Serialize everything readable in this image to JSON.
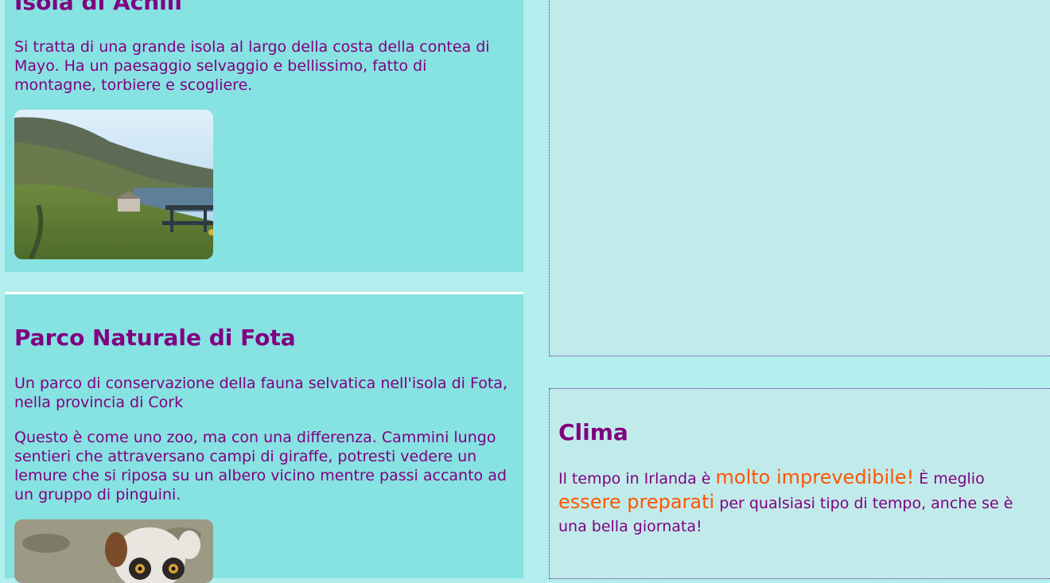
{
  "sections": [
    {
      "title": "Isola di Achill",
      "paragraphs": [
        "Si tratta di una grande isola al largo della costa della contea di Mayo. Ha un paesaggio selvaggio e bellissimo, fatto di montagne, torbiere e scogliere."
      ],
      "image_desc": "coastal landscape with cottage and picnic bench"
    },
    {
      "title": "Parco Naturale di Fota",
      "paragraphs": [
        "Un parco di conservazione della fauna selvatica nell'isola di Fota, nella provincia di Cork",
        "Questo è come uno zoo, ma con una differenza. Cammini lungo sentieri che attraversano campi di giraffe, potresti vedere un lemure che si riposa su un albero vicino mentre passi accanto ad un gruppo di pinguini."
      ],
      "image_desc": "ring-tailed lemur"
    }
  ],
  "clima": {
    "title": "Clima",
    "text_1": "Il tempo in Irlanda è ",
    "highlight_1": "molto imprevedibile!",
    "text_2": " È meglio ",
    "highlight_2": "essere preparati",
    "text_3": " per qualsiasi tipo di tempo, anche se è una bella giornata!"
  },
  "colors": {
    "page_bg": "#b2eeee",
    "card_bg": "#87e2e2",
    "sidebar_bg": "#c1ebeb",
    "text": "#800080",
    "highlight": "#ff5500"
  }
}
